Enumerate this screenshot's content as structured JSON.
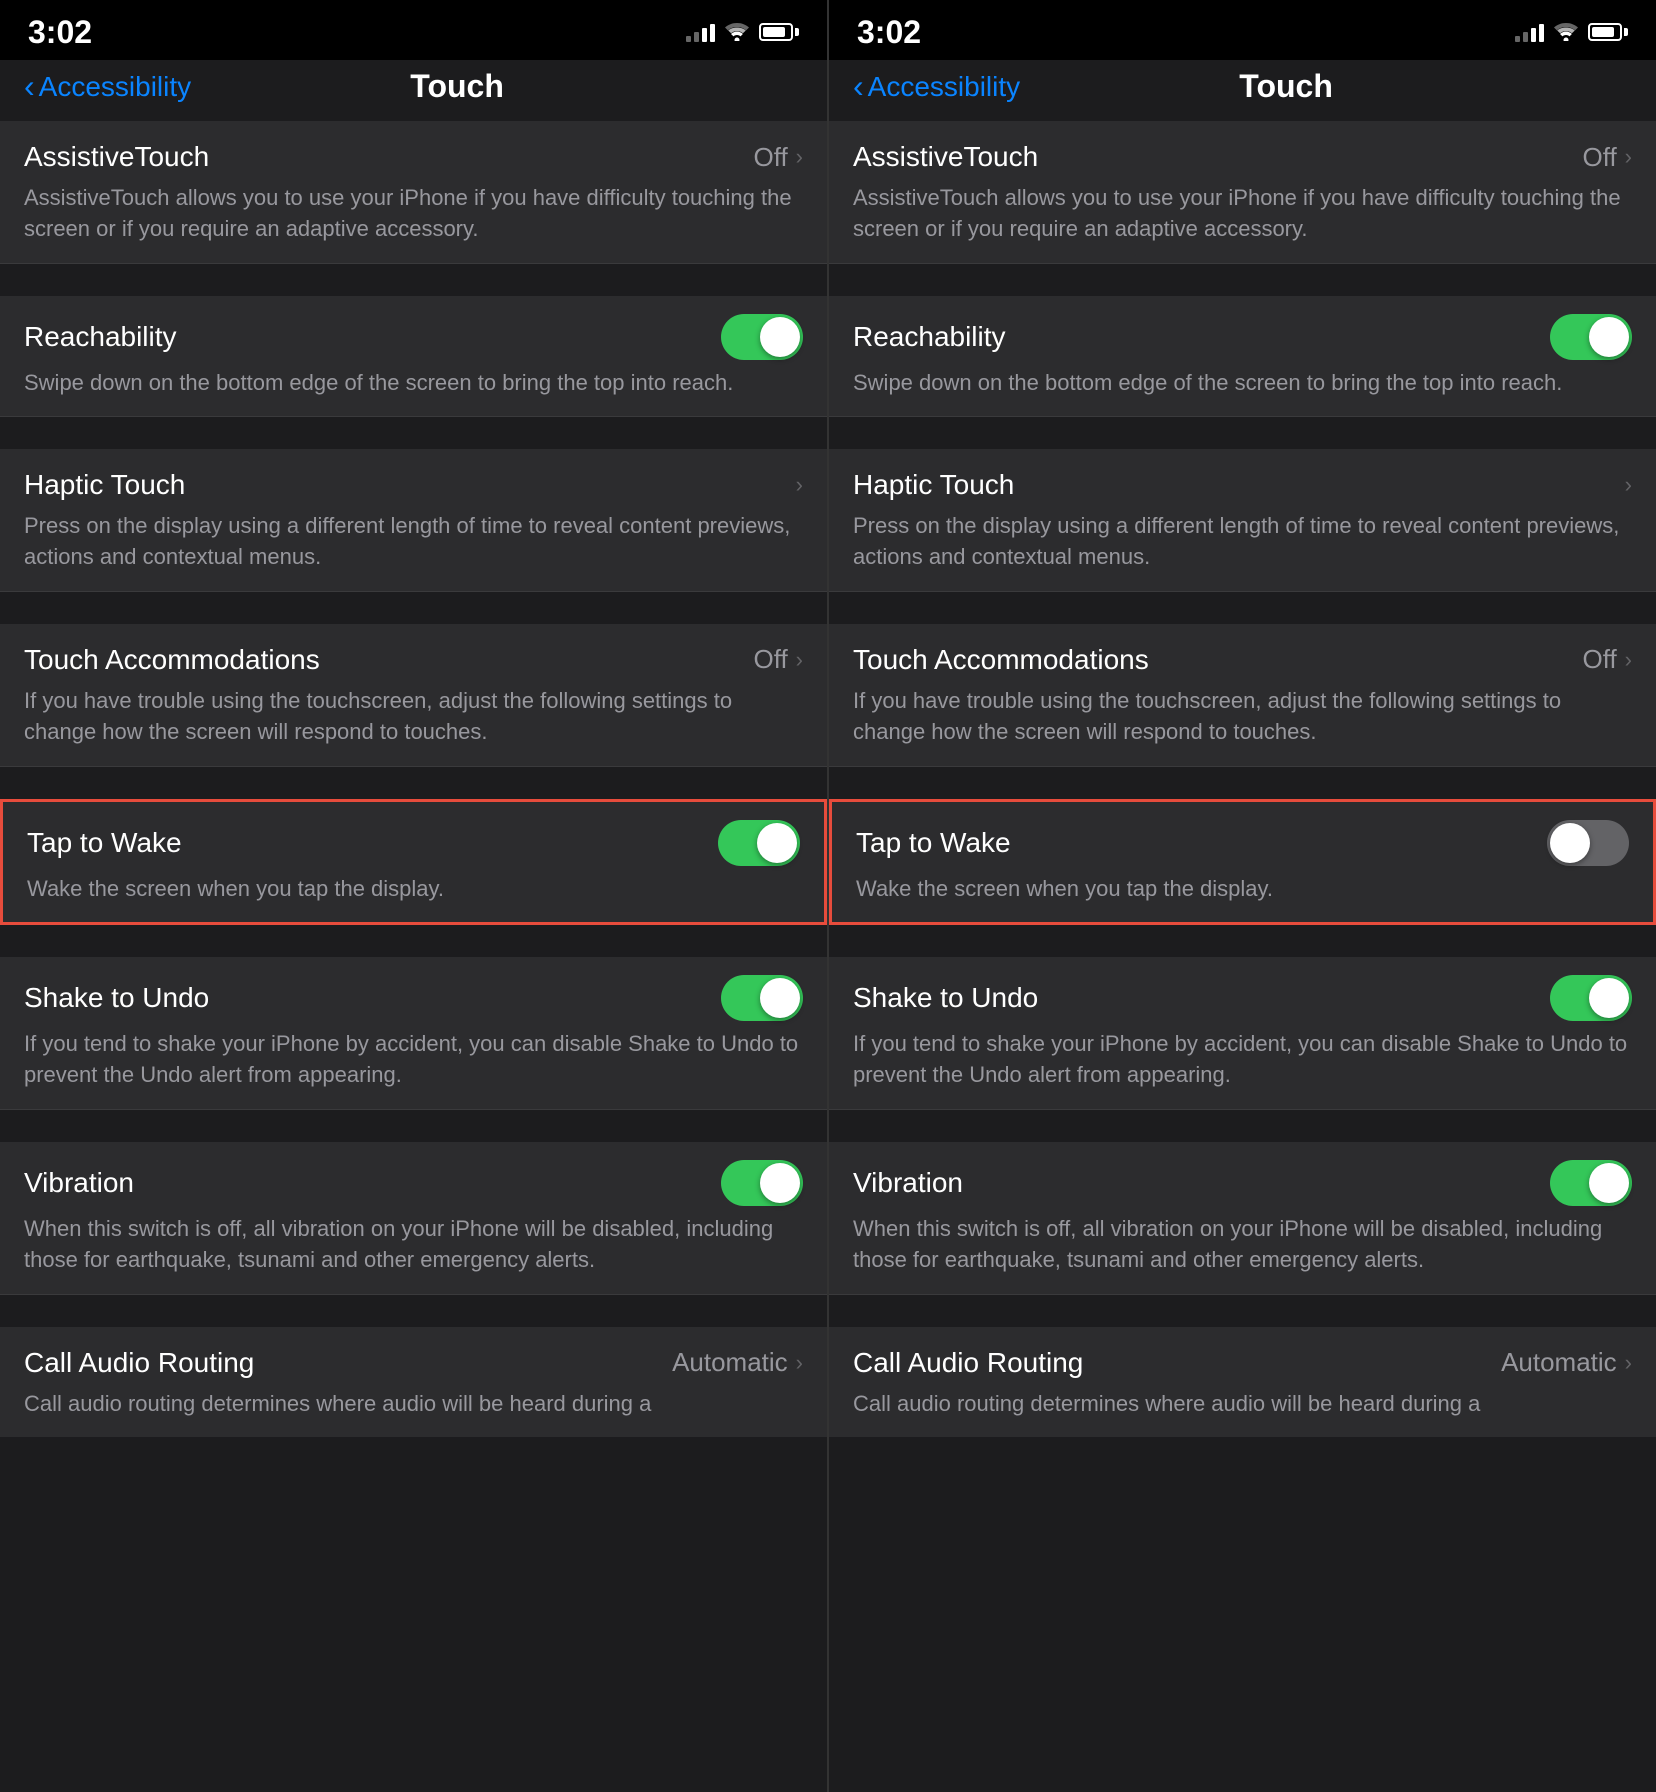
{
  "left_phone": {
    "status": {
      "time": "3:02"
    },
    "nav": {
      "back_label": "Accessibility",
      "title": "Touch"
    },
    "settings": [
      {
        "id": "assistivetouch",
        "title": "AssistiveTouch",
        "value": "Off",
        "has_chevron": true,
        "description": "AssistiveTouch allows you to use your iPhone if you have difficulty touching the screen or if you require an adaptive accessory.",
        "toggle": null
      },
      {
        "id": "reachability",
        "title": "Reachability",
        "toggle": "on",
        "description": "Swipe down on the bottom edge of the screen to bring the top into reach."
      },
      {
        "id": "haptic-touch",
        "title": "Haptic Touch",
        "has_chevron": true,
        "description": "Press on the display using a different length of time to reveal content previews, actions and contextual menus."
      },
      {
        "id": "touch-accommodations",
        "title": "Touch Accommodations",
        "value": "Off",
        "has_chevron": true,
        "description": "If you have trouble using the touchscreen, adjust the following settings to change how the screen will respond to touches."
      },
      {
        "id": "tap-to-wake",
        "title": "Tap to Wake",
        "toggle": "on",
        "description": "Wake the screen when you tap the display.",
        "highlight": true
      },
      {
        "id": "shake-to-undo",
        "title": "Shake to Undo",
        "toggle": "on",
        "description": "If you tend to shake your iPhone by accident, you can disable Shake to Undo to prevent the Undo alert from appearing."
      },
      {
        "id": "vibration",
        "title": "Vibration",
        "toggle": "on",
        "description": "When this switch is off, all vibration on your iPhone will be disabled, including those for earthquake, tsunami and other emergency alerts."
      },
      {
        "id": "call-audio-routing",
        "title": "Call Audio Routing",
        "value": "Automatic",
        "has_chevron": true,
        "description": "Call audio routing determines where audio will be heard during a"
      }
    ]
  },
  "right_phone": {
    "status": {
      "time": "3:02"
    },
    "nav": {
      "back_label": "Accessibility",
      "title": "Touch"
    },
    "settings": [
      {
        "id": "assistivetouch",
        "title": "AssistiveTouch",
        "value": "Off",
        "has_chevron": true,
        "description": "AssistiveTouch allows you to use your iPhone if you have difficulty touching the screen or if you require an adaptive accessory.",
        "toggle": null
      },
      {
        "id": "reachability",
        "title": "Reachability",
        "toggle": "on",
        "description": "Swipe down on the bottom edge of the screen to bring the top into reach."
      },
      {
        "id": "haptic-touch",
        "title": "Haptic Touch",
        "has_chevron": true,
        "description": "Press on the display using a different length of time to reveal content previews, actions and contextual menus."
      },
      {
        "id": "touch-accommodations",
        "title": "Touch Accommodations",
        "value": "Off",
        "has_chevron": true,
        "description": "If you have trouble using the touchscreen, adjust the following settings to change how the screen will respond to touches."
      },
      {
        "id": "tap-to-wake",
        "title": "Tap to Wake",
        "toggle": "off",
        "description": "Wake the screen when you tap the display.",
        "highlight": true
      },
      {
        "id": "shake-to-undo",
        "title": "Shake to Undo",
        "toggle": "on",
        "description": "If you tend to shake your iPhone by accident, you can disable Shake to Undo to prevent the Undo alert from appearing."
      },
      {
        "id": "vibration",
        "title": "Vibration",
        "toggle": "on",
        "description": "When this switch is off, all vibration on your iPhone will be disabled, including those for earthquake, tsunami and other emergency alerts."
      },
      {
        "id": "call-audio-routing",
        "title": "Call Audio Routing",
        "value": "Automatic",
        "has_chevron": true,
        "description": "Call audio routing determines where audio will be heard during a"
      }
    ]
  }
}
